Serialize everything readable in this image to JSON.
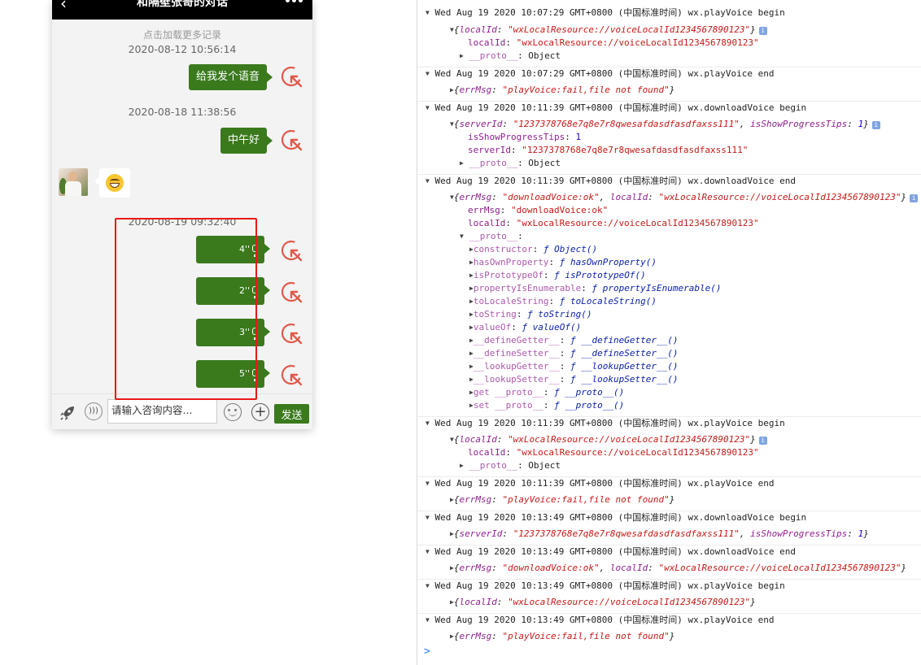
{
  "chat": {
    "title": "和隔壁张哥的对话",
    "load_more": "点击加载更多记录",
    "timestamps": [
      "2020-08-12 10:56:14",
      "2020-08-18 11:38:56",
      "2020-08-19 09:32:40"
    ],
    "messages": [
      {
        "type": "text",
        "side": "right",
        "text": "给我发个语音"
      },
      {
        "type": "text",
        "side": "right",
        "text": "中午好"
      },
      {
        "type": "emoji",
        "side": "left",
        "emoji": "grinning-face"
      },
      {
        "type": "voice",
        "side": "right",
        "duration": "4''"
      },
      {
        "type": "voice",
        "side": "right",
        "duration": "2''"
      },
      {
        "type": "voice",
        "side": "right",
        "duration": "3''"
      },
      {
        "type": "voice",
        "side": "right",
        "duration": "5''"
      }
    ],
    "input_placeholder": "请输入咨询内容...",
    "send_label": "发送",
    "accent": "#3a7a1d",
    "highlight_color": "#e8191a"
  },
  "console": {
    "rows": [
      {
        "kind": "header",
        "text": "Wed Aug 19 2020 10:07:29 GMT+0800 (中国标准时间) wx.playVoice begin"
      },
      {
        "kind": "expanded_obj",
        "text": "{localId: \"wxLocalResource://voiceLocalId1234567890123\"}"
      },
      {
        "kind": "prop",
        "key": "localId",
        "value": "\"wxLocalResource://voiceLocalId1234567890123\""
      },
      {
        "kind": "proto",
        "text": "__proto__: Object"
      },
      {
        "kind": "header",
        "text": "Wed Aug 19 2020 10:07:29 GMT+0800 (中国标准时间) wx.playVoice end"
      },
      {
        "kind": "collapsed_obj",
        "text": "{errMsg: \"playVoice:fail,file not found\"}"
      },
      {
        "kind": "header",
        "text": "Wed Aug 19 2020 10:11:39 GMT+0800 (中国标准时间) wx.downloadVoice begin"
      },
      {
        "kind": "expanded_obj",
        "text": "{serverId: \"1237378768e7q8e7r8qwesafdasdfasdfaxss111\", isShowProgressTips: 1}"
      },
      {
        "kind": "prop",
        "key": "isShowProgressTips",
        "value": "1"
      },
      {
        "kind": "prop",
        "key": "serverId",
        "value": "\"1237378768e7q8e7r8qwesafdasdfasdfaxss111\""
      },
      {
        "kind": "proto",
        "text": "__proto__: Object"
      },
      {
        "kind": "header",
        "text": "Wed Aug 19 2020 10:11:39 GMT+0800 (中国标准时间) wx.downloadVoice end"
      },
      {
        "kind": "expanded_obj",
        "text": "{errMsg: \"downloadVoice:ok\", localId: \"wxLocalResource://voiceLocalId1234567890123\"}"
      },
      {
        "kind": "prop",
        "key": "errMsg",
        "value": "\"downloadVoice:ok\""
      },
      {
        "kind": "prop",
        "key": "localId",
        "value": "\"wxLocalResource://voiceLocalId1234567890123\""
      },
      {
        "kind": "proto_open",
        "text": "__proto__:"
      },
      {
        "kind": "method",
        "key": "constructor",
        "value": "ƒ Object()"
      },
      {
        "kind": "method",
        "key": "hasOwnProperty",
        "value": "ƒ hasOwnProperty()"
      },
      {
        "kind": "method",
        "key": "isPrototypeOf",
        "value": "ƒ isPrototypeOf()"
      },
      {
        "kind": "method",
        "key": "propertyIsEnumerable",
        "value": "ƒ propertyIsEnumerable()"
      },
      {
        "kind": "method",
        "key": "toLocaleString",
        "value": "ƒ toLocaleString()"
      },
      {
        "kind": "method",
        "key": "toString",
        "value": "ƒ toString()"
      },
      {
        "kind": "method",
        "key": "valueOf",
        "value": "ƒ valueOf()"
      },
      {
        "kind": "method",
        "key": "__defineGetter__",
        "value": "ƒ __defineGetter__()"
      },
      {
        "kind": "method",
        "key": "__defineSetter__",
        "value": "ƒ __defineSetter__()"
      },
      {
        "kind": "method",
        "key": "__lookupGetter__",
        "value": "ƒ __lookupGetter__()"
      },
      {
        "kind": "method",
        "key": "__lookupSetter__",
        "value": "ƒ __lookupSetter__()"
      },
      {
        "kind": "method",
        "key": "get __proto__",
        "value": "ƒ __proto__()"
      },
      {
        "kind": "method",
        "key": "set __proto__",
        "value": "ƒ __proto__()"
      },
      {
        "kind": "header",
        "text": "Wed Aug 19 2020 10:11:39 GMT+0800 (中国标准时间) wx.playVoice begin"
      },
      {
        "kind": "expanded_obj",
        "text": "{localId: \"wxLocalResource://voiceLocalId1234567890123\"}"
      },
      {
        "kind": "prop",
        "key": "localId",
        "value": "\"wxLocalResource://voiceLocalId1234567890123\""
      },
      {
        "kind": "proto",
        "text": "__proto__: Object"
      },
      {
        "kind": "header",
        "text": "Wed Aug 19 2020 10:11:39 GMT+0800 (中国标准时间) wx.playVoice end"
      },
      {
        "kind": "collapsed_obj",
        "text": "{errMsg: \"playVoice:fail,file not found\"}"
      },
      {
        "kind": "header",
        "text": "Wed Aug 19 2020 10:13:49 GMT+0800 (中国标准时间) wx.downloadVoice begin"
      },
      {
        "kind": "collapsed_obj",
        "text": "{serverId: \"1237378768e7q8e7r8qwesafdasdfasdfaxss111\", isShowProgressTips: 1}"
      },
      {
        "kind": "header",
        "text": "Wed Aug 19 2020 10:13:49 GMT+0800 (中国标准时间) wx.downloadVoice end"
      },
      {
        "kind": "collapsed_obj",
        "text": "{errMsg: \"downloadVoice:ok\", localId: \"wxLocalResource://voiceLocalId1234567890123\"}"
      },
      {
        "kind": "header",
        "text": "Wed Aug 19 2020 10:13:49 GMT+0800 (中国标准时间) wx.playVoice begin"
      },
      {
        "kind": "collapsed_obj",
        "text": "{localId: \"wxLocalResource://voiceLocalId1234567890123\"}"
      },
      {
        "kind": "header",
        "text": "Wed Aug 19 2020 10:13:49 GMT+0800 (中国标准时间) wx.playVoice end"
      },
      {
        "kind": "collapsed_obj",
        "text": "{errMsg: \"playVoice:fail,file not found\"}"
      }
    ],
    "prompt": ">"
  }
}
